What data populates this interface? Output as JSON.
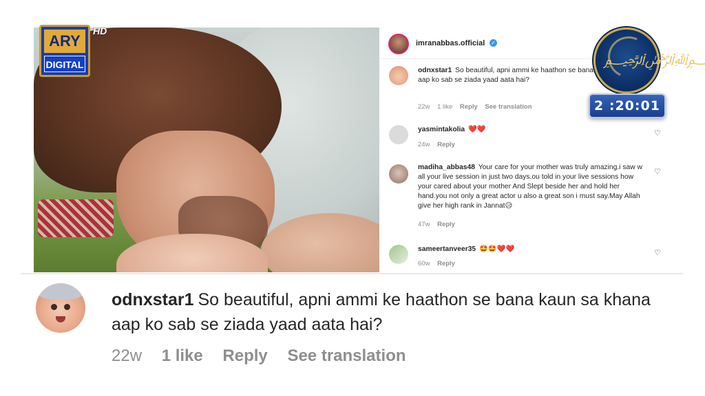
{
  "channel": {
    "logo_top": "ARY",
    "logo_bottom": "DIGITAL",
    "hd": "HD"
  },
  "post": {
    "username": "imranabbas.official",
    "verified_icon": "verified-badge-icon",
    "accent_color": "#3897f0"
  },
  "comments": [
    {
      "username": "odnxstar1",
      "text": "So beautiful, apni ammi ke haathon se bana kaun sa khana aap ko sab se ziada yaad aata hai?",
      "age": "22w",
      "likes": "1 like",
      "reply": "Reply",
      "translation": "See translation"
    },
    {
      "username": "yasmintakolia",
      "text": "❤️❤️",
      "age": "24w",
      "reply": "Reply"
    },
    {
      "username": "madiha_abbas48",
      "text": "Your care for your mother was truly amazing.i saw w all your live session in just two days.ou told in your live sessions how your cared about your mother And Slept beside her and hold her hand.you not only a great actor u also a great son i must say.May Allah give her high rank in Jannat😥",
      "age": "47w",
      "reply": "Reply"
    },
    {
      "username": "sameertanveer35",
      "text": "🤩🤩❤️❤️",
      "age": "60w",
      "reply": "Reply"
    }
  ],
  "timer": {
    "value": "2 :20:01"
  },
  "featured": {
    "username": "odnxstar1",
    "text": "So beautiful, apni ammi ke haathon se bana kaun sa khana aap ko sab se ziada yaad aata hai?",
    "age": "22w",
    "likes": "1 like",
    "reply": "Reply",
    "translation": "See translation"
  }
}
